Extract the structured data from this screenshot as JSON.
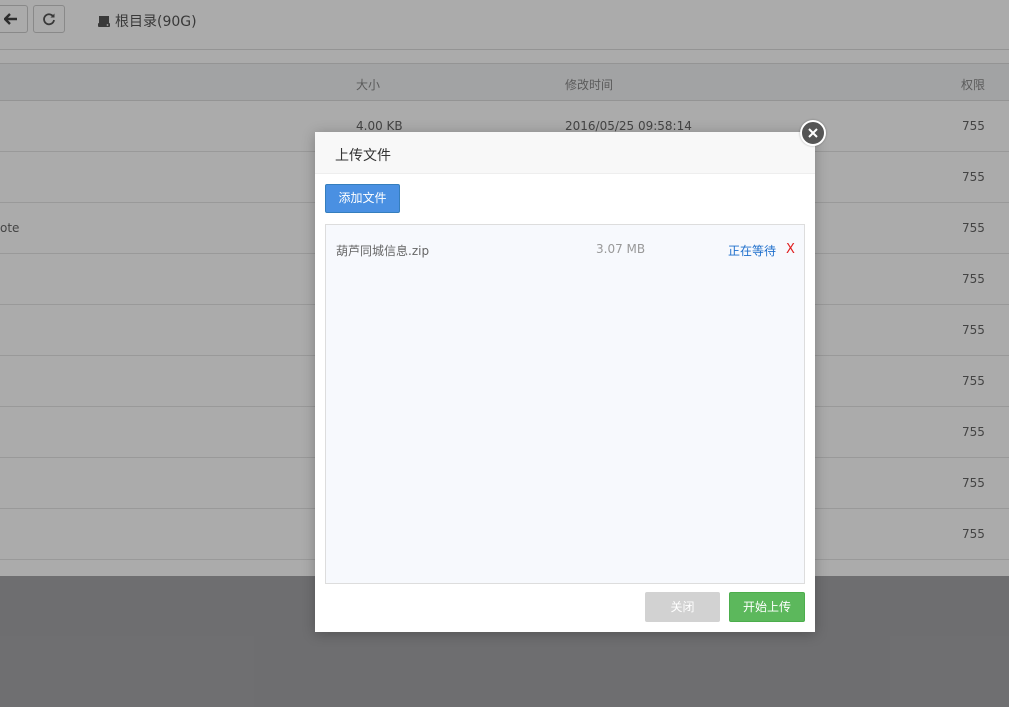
{
  "toolbar": {
    "path_label": "根目录(90G)"
  },
  "table": {
    "columns": [
      "大小",
      "修改时间",
      "权限"
    ],
    "rows": [
      {
        "name": "",
        "size": "4.00 KB",
        "modified": "2016/05/25 09:58:14",
        "perm": "755"
      },
      {
        "name": "",
        "size": "",
        "modified": "",
        "perm": "755"
      },
      {
        "name": "ote",
        "size": "",
        "modified": "",
        "perm": "755"
      },
      {
        "name": "",
        "size": "",
        "modified": "",
        "perm": "755"
      },
      {
        "name": "",
        "size": "",
        "modified": "",
        "perm": "755"
      },
      {
        "name": "",
        "size": "",
        "modified": "",
        "perm": "755"
      },
      {
        "name": "",
        "size": "",
        "modified": "",
        "perm": "755"
      },
      {
        "name": "",
        "size": "",
        "modified": "",
        "perm": "755"
      },
      {
        "name": "",
        "size": "",
        "modified": "",
        "perm": "755"
      }
    ]
  },
  "modal": {
    "title": "上传文件",
    "add_label": "添加文件",
    "files": [
      {
        "name": "葫芦同城信息.zip",
        "size": "3.07 MB",
        "status": "正在等待",
        "remove": "X"
      }
    ],
    "close_label": "关闭",
    "start_label": "开始上传"
  },
  "colors": {
    "primary": "#4a90e2",
    "success": "#5cb85c",
    "link": "#1e6fcc",
    "danger": "#e02020"
  },
  "icons": [
    "arrow-left-icon",
    "refresh-icon",
    "drive-icon",
    "close-circle-icon"
  ]
}
